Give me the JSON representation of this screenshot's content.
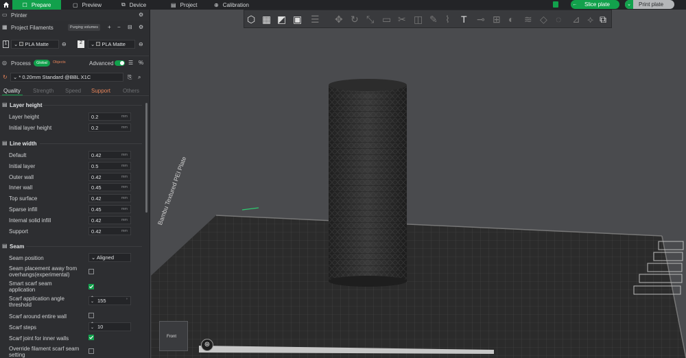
{
  "topbar": {
    "home_icon": "home-icon",
    "tabs": [
      {
        "label": "Prepare",
        "active": true
      },
      {
        "label": "Preview"
      },
      {
        "label": "Device"
      },
      {
        "label": "Project"
      },
      {
        "label": "Calibration"
      }
    ],
    "slice": "Slice plate",
    "print": "Print plate"
  },
  "sidebar": {
    "printer": "Printer",
    "project_filaments": "Project Filaments",
    "purging_volumes": "Purging volumes",
    "filaments": [
      {
        "num": "1",
        "name": "PLA Matte"
      },
      {
        "num": "2",
        "name": "PLA Matte"
      }
    ],
    "process": "Process",
    "global": "Global",
    "objects": "Objects",
    "advanced": "Advanced",
    "preset": "* 0.20mm Standard @BBL X1C",
    "subtabs": [
      "Quality",
      "Strength",
      "Speed",
      "Support",
      "Others"
    ],
    "layer_height": {
      "title": "Layer height",
      "rows": [
        {
          "label": "Layer height",
          "value": "0.2",
          "unit": "mm"
        },
        {
          "label": "Initial layer height",
          "value": "0.2",
          "unit": "mm"
        }
      ]
    },
    "line_width": {
      "title": "Line width",
      "rows": [
        {
          "label": "Default",
          "value": "0.42",
          "unit": "mm"
        },
        {
          "label": "Initial layer",
          "value": "0.5",
          "unit": "mm"
        },
        {
          "label": "Outer wall",
          "value": "0.42",
          "unit": "mm"
        },
        {
          "label": "Inner wall",
          "value": "0.45",
          "unit": "mm"
        },
        {
          "label": "Top surface",
          "value": "0.42",
          "unit": "mm"
        },
        {
          "label": "Sparse infill",
          "value": "0.45",
          "unit": "mm"
        },
        {
          "label": "Internal solid infill",
          "value": "0.42",
          "unit": "mm"
        },
        {
          "label": "Support",
          "value": "0.42",
          "unit": "mm"
        }
      ]
    },
    "seam": {
      "title": "Seam",
      "position_label": "Seam position",
      "position_value": "Aligned",
      "away_label": "Seam placement away from overhangs(experimental)",
      "smart_label": "Smart scarf seam application",
      "angle_label": "Scarf application angle threshold",
      "angle_value": "155",
      "around_label": "Scarf around entire wall",
      "steps_label": "Scarf steps",
      "steps_value": "10",
      "inner_label": "Scarf joint for inner walls",
      "override_label": "Override filament scarf seam setting"
    }
  },
  "viewport": {
    "plate_label": "Bambu Textured PEI Plate",
    "cube_label": "Front"
  }
}
